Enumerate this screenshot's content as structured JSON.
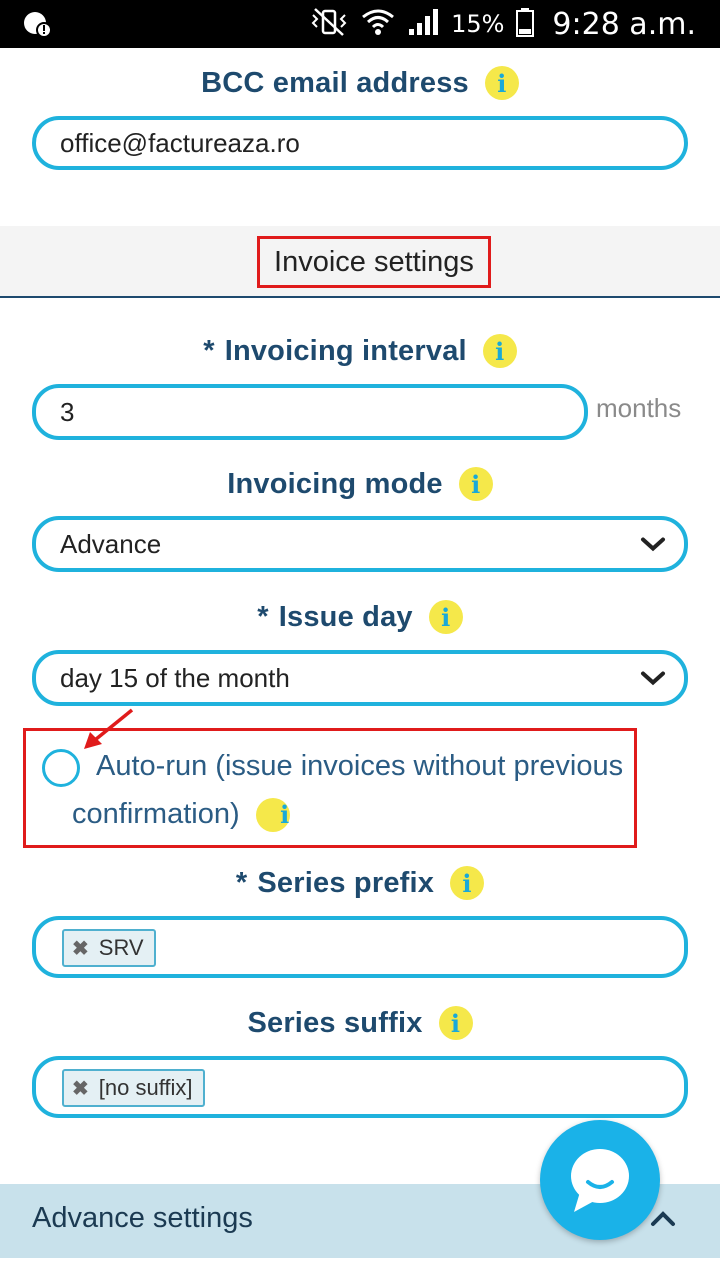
{
  "status_bar": {
    "battery_percent": "15%",
    "time": "9:28 a.m."
  },
  "bcc": {
    "label": "BCC email address",
    "value": "office@factureaza.ro"
  },
  "section": {
    "title": "Invoice settings"
  },
  "interval": {
    "required_mark": "*",
    "label": "Invoicing interval",
    "value": "3",
    "unit": "months"
  },
  "mode": {
    "label": "Invoicing mode",
    "selected": "Advance"
  },
  "issue_day": {
    "required_mark": "*",
    "label": "Issue day",
    "selected": "day 15 of the month"
  },
  "autorun": {
    "label": "Auto-run (issue invoices without previous confirmation)",
    "checked": false
  },
  "series_prefix": {
    "required_mark": "*",
    "label": "Series prefix",
    "tag": "SRV"
  },
  "series_suffix": {
    "label": "Series suffix",
    "tag": "[no suffix]"
  },
  "advance_settings": {
    "label": "Advance settings"
  },
  "info_glyph": "i",
  "remove_glyph": "✖",
  "colors": {
    "accent": "#1fb2dd",
    "label": "#1e4a6e",
    "info_bg": "#f5e84a",
    "highlight": "#e01b1b",
    "chat": "#1ab2e8"
  }
}
